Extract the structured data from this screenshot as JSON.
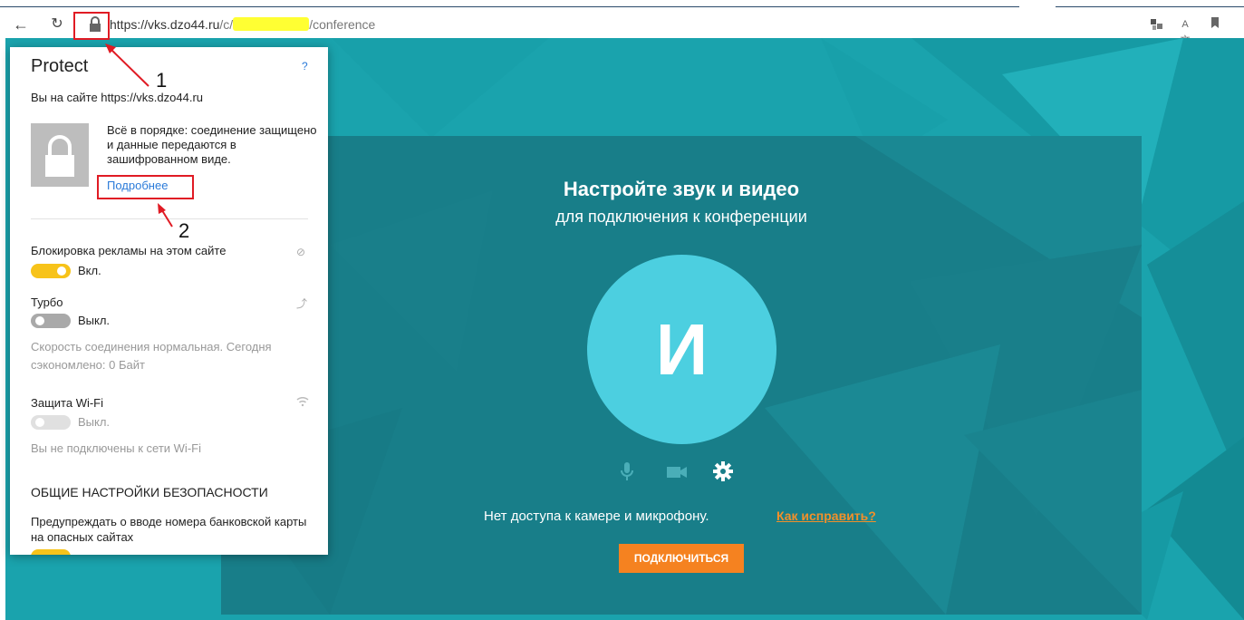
{
  "browser": {
    "url_path_start": "https://vks.dzo44.ru",
    "url_path_mid": "/c/",
    "url_path_end": "/conference"
  },
  "popup": {
    "title": "Protect",
    "help": "?",
    "site_text": "Вы на сайте https://vks.dzo44.ru",
    "status_text": "Всё в порядке: соединение защищено и данные передаются в зашифрованном виде.",
    "more_link": "Подробнее",
    "ads": {
      "label": "Блокировка рекламы на этом сайте",
      "state": "Вкл.",
      "on": true
    },
    "turbo": {
      "label": "Турбо",
      "state": "Выкл.",
      "on": false,
      "note": "Скорость соединения нормальная. Сегодня сэкономлено: 0 Байт"
    },
    "wifi": {
      "label": "Защита Wi-Fi",
      "state": "Выкл.",
      "on": false,
      "note": "Вы не подключены к сети Wi-Fi"
    },
    "section_title": "ОБЩИЕ НАСТРОЙКИ БЕЗОПАСНОСТИ",
    "bank_warning": "Предупреждать о вводе номера банковской карты на опасных сайтах"
  },
  "annotations": {
    "one": "1",
    "two": "2"
  },
  "page": {
    "title": "Настройте звук и видео",
    "subtitle": "для подключения к конференции",
    "avatar_letter": "И",
    "error_text": "Нет доступа к камере и микрофону.",
    "fix_link": "Как исправить?",
    "connect_button": "ПОДКЛЮЧИТЬСЯ"
  },
  "colors": {
    "page_bg": "#1aa3ad",
    "card_bg": "#187e89",
    "avatar": "#4ccfe0",
    "accent_orange": "#f58220",
    "toggle_on": "#f7c31a",
    "annotation_red": "#e01b24"
  },
  "icons": [
    "back-arrow-icon",
    "reload-icon",
    "lock-icon",
    "translate-icon",
    "bookmark-icon",
    "mic-icon",
    "camera-icon",
    "gear-icon"
  ]
}
